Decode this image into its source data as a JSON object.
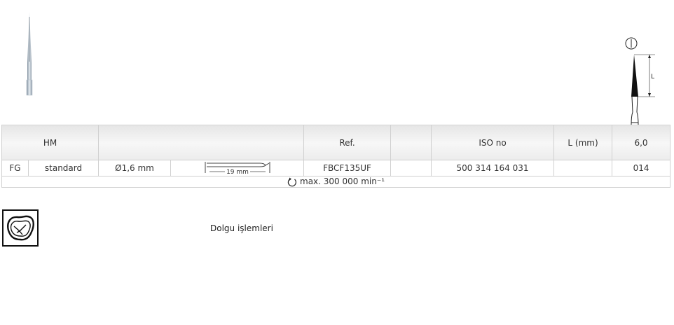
{
  "table": {
    "header": {
      "material": "HM",
      "ref_label": "Ref.",
      "iso_label": "ISO no",
      "length_label": "L (mm)",
      "length_value": "6,0"
    },
    "row": {
      "shank": "FG",
      "type": "standard",
      "diameter": "Ø1,6 mm",
      "shank_length": "19 mm",
      "ref": "FBCF135UF",
      "iso": "500 314 164 031",
      "size": "014"
    },
    "footer": {
      "speed": "max. 300 000 min⁻¹"
    }
  },
  "application": {
    "label": "Dolgu işlemleri"
  },
  "diagram": {
    "length_marker": "L"
  }
}
